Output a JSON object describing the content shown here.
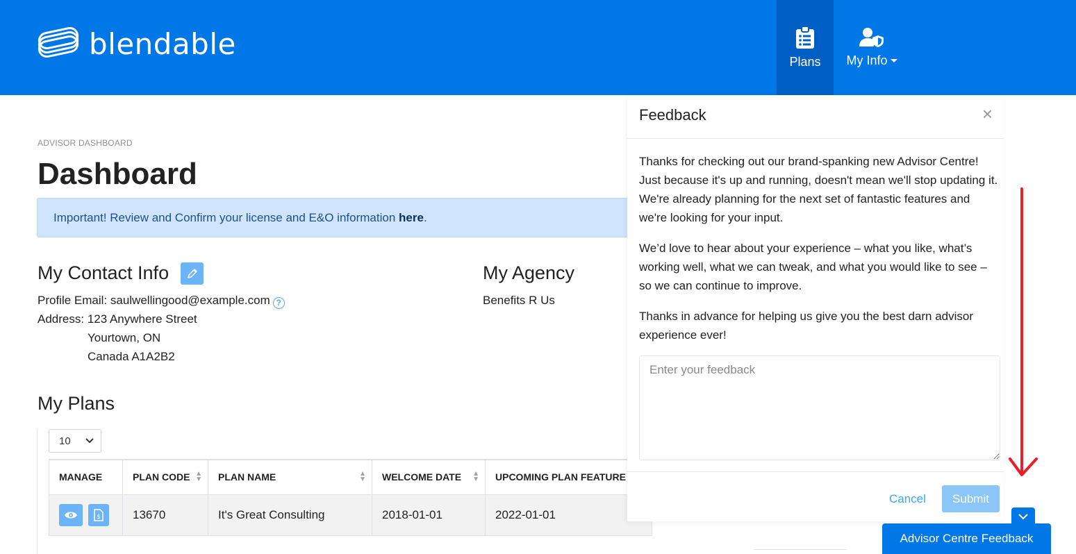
{
  "header": {
    "logo_text": "blendable",
    "nav": [
      {
        "label": "Plans",
        "icon": "clipboard-list-icon",
        "active": true
      },
      {
        "label": "My Info",
        "icon": "user-shield-icon",
        "dropdown": true
      }
    ],
    "bg_color": "#0077e6"
  },
  "page": {
    "breadcrumb": "ADVISOR DASHBOARD",
    "title": "Dashboard"
  },
  "alert": {
    "text": "Important! Review and Confirm your license and E&O information ",
    "link": "here",
    "suffix": "."
  },
  "contact": {
    "title": "My Contact Info",
    "email_label": "Profile Email: ",
    "email": "saulwellingood@example.com",
    "address_label": "Address: ",
    "address_line1": "123 Anywhere Street",
    "address_line2": "Yourtown, ON",
    "address_line3": "Canada A1A2B2"
  },
  "agency": {
    "title": "My Agency",
    "name": "Benefits R Us"
  },
  "plans": {
    "title": "My Plans",
    "page_length": "10",
    "columns": [
      "MANAGE",
      "PLAN CODE",
      "PLAN NAME",
      "WELCOME DATE",
      "UPCOMING PLAN FEATURE RE"
    ],
    "rows": [
      {
        "plan_code": "13670",
        "plan_name": "It's Great Consulting",
        "welcome_date": "2018-01-01",
        "upcoming": "2022-01-01"
      }
    ]
  },
  "feedback": {
    "title": "Feedback",
    "close": "×",
    "paragraphs": [
      "Thanks for checking out our brand-spanking new Advisor Centre! Just because it's up and running, doesn't mean we'll stop updating it. We're already planning for the next set of fantastic features and we're looking for your input.",
      "We’d love to hear about your experience – what you like, what’s working well, what we can tweak, and what you would like to see – so we can continue to improve.",
      "Thanks in advance for helping us give you the best darn advisor experience ever!"
    ],
    "placeholder": "Enter your feedback",
    "cancel": "Cancel",
    "submit": "Submit",
    "tab_label": "Advisor Centre Feedback"
  }
}
